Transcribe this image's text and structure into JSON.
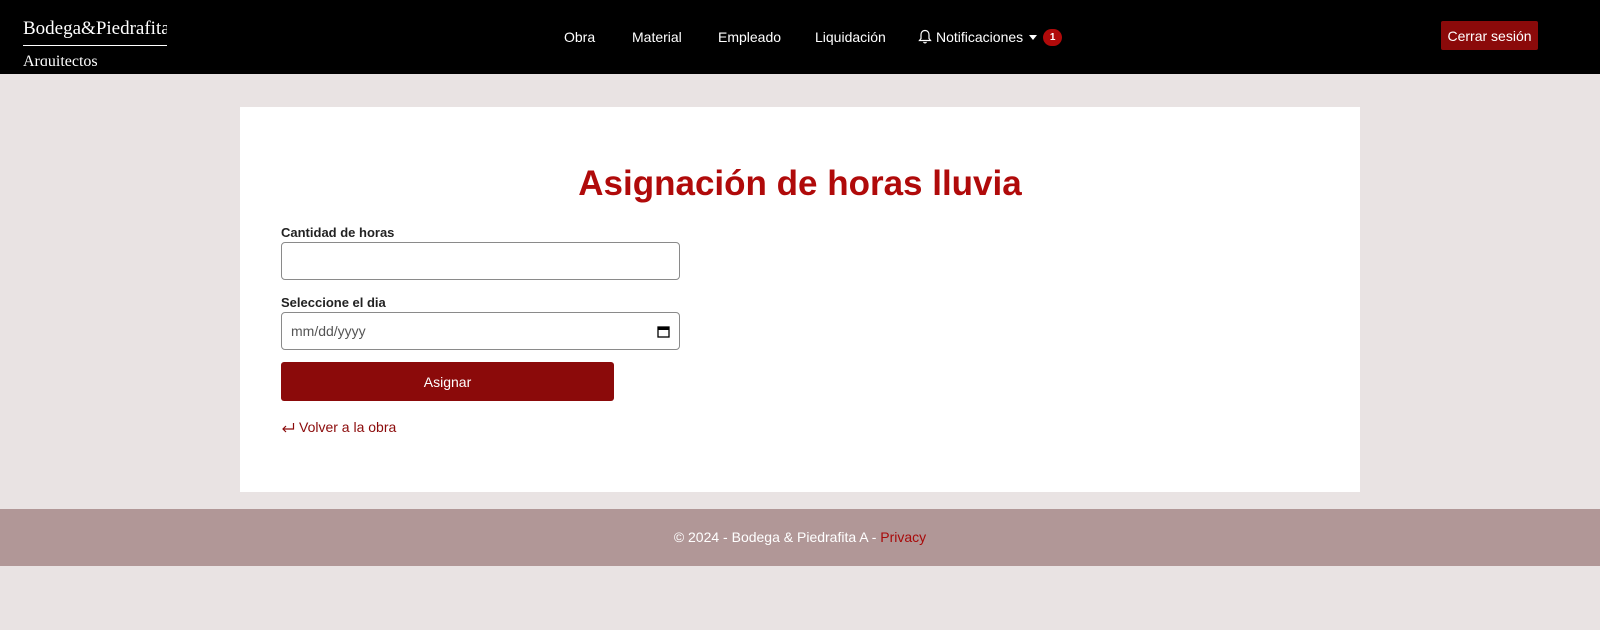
{
  "brand": {
    "line1": "Bodega&Piedrafita",
    "line2": "Arquitectos"
  },
  "nav": {
    "items": [
      {
        "label": "Obra"
      },
      {
        "label": "Material"
      },
      {
        "label": "Empleado"
      },
      {
        "label": "Liquidación"
      }
    ],
    "notifications": {
      "label": "Notificaciones",
      "count": "1",
      "icon": "bell-icon"
    },
    "logout_label": "Cerrar sesión"
  },
  "form": {
    "title": "Asignación de horas lluvia",
    "hours_label": "Cantidad de horas",
    "hours_value": "",
    "day_label": "Seleccione el dia",
    "day_placeholder": "mm/dd/yyyy",
    "submit_label": "Asignar",
    "back_label": "Volver a la obra"
  },
  "footer": {
    "text": "© 2024 - Bodega & Piedrafita A -",
    "privacy_label": "Privacy"
  },
  "colors": {
    "accent": "#8b0a0a",
    "title": "#b00a0a",
    "navbar": "#000000",
    "footer": "#b19797",
    "background": "#e9e3e3"
  }
}
